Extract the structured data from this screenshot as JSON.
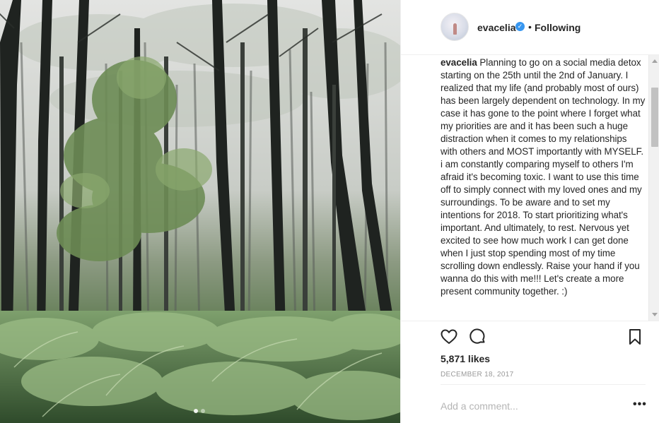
{
  "post": {
    "username": "evacelia",
    "verified_badge": "✓",
    "separator": "•",
    "follow_state": "Following",
    "caption_user": "evacelia",
    "caption_text": "Planning to go on a social media detox starting on the 25th until the 2nd of January. I realized that my life (and probably most of ours) has been largely dependent on technology. In my case it has gone to the point where I forget what my priorities are and it has been such a huge distraction when it comes to my relationships with others and MOST importantly with MYSELF. i am constantly comparing myself to others I'm afraid it's becoming toxic. I want to use this time off to simply connect with my loved ones and my surroundings. To be aware and to set my intentions for 2018. To start prioritizing what's important. And ultimately, to rest. Nervous yet excited to see how much work I can get done when I just stop spending most of my time scrolling down endlessly. Raise your hand if you wanna do this with me!!! Let's create a more present community together. :)",
    "likes": "5,871 likes",
    "date": "December 18, 2017"
  },
  "comment": {
    "placeholder": "Add a comment...",
    "more_label": "•••"
  },
  "icons": {
    "like": "heart-icon",
    "comment": "comment-bubble-icon",
    "save": "bookmark-icon",
    "verified": "verified-badge-icon"
  },
  "colors": {
    "verified_blue": "#3897f0",
    "text": "#262626",
    "muted": "#999999"
  }
}
